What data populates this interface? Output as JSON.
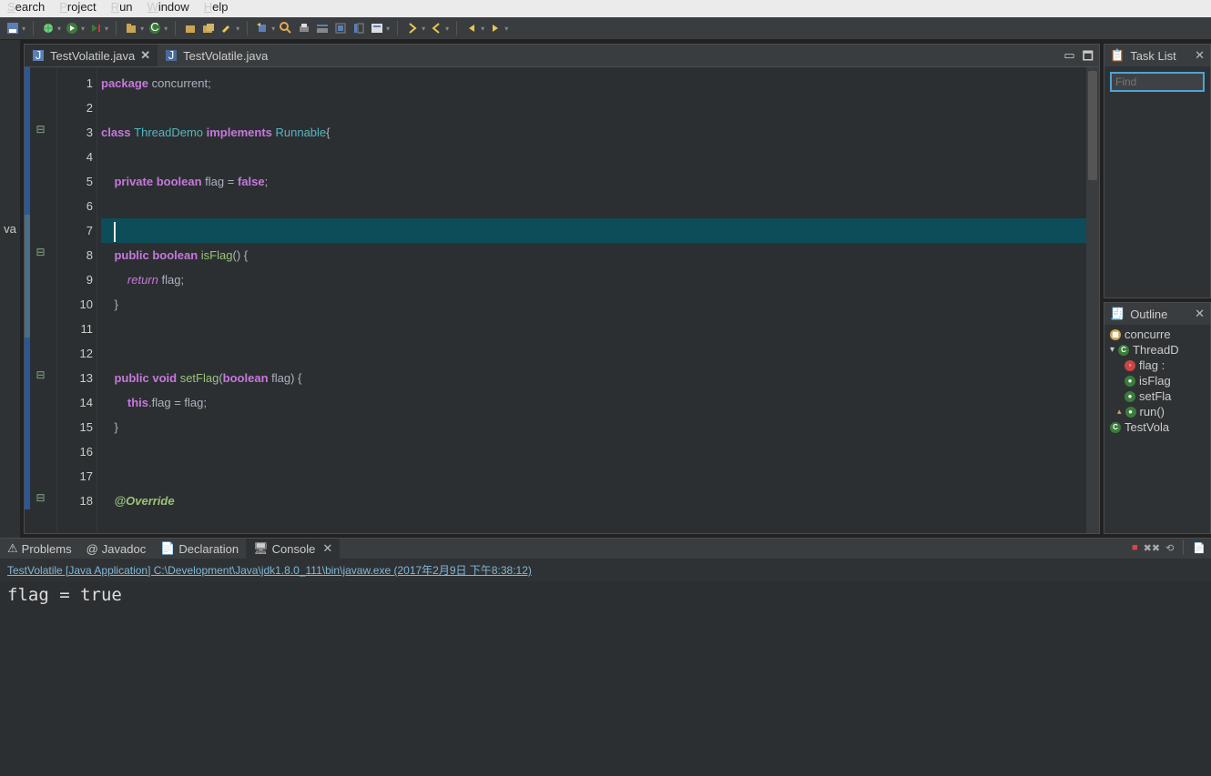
{
  "menu": {
    "items": [
      "Search",
      "Project",
      "Run",
      "Window",
      "Help"
    ],
    "ul": [
      "S",
      "P",
      "R",
      "W",
      "H"
    ]
  },
  "left_sash_label": "va",
  "tabs": [
    {
      "name": "TestVolatile.java",
      "active": true,
      "closeable": true
    },
    {
      "name": "TestVolatile.java",
      "active": false,
      "closeable": false
    }
  ],
  "code": [
    {
      "n": 1,
      "strip": 2,
      "tokens": [
        {
          "t": "package ",
          "c": "kw"
        },
        {
          "t": "concurrent",
          "c": "id"
        },
        {
          "t": ";",
          "c": "p"
        }
      ]
    },
    {
      "n": 2,
      "strip": 2,
      "tokens": []
    },
    {
      "n": 3,
      "strip": 2,
      "tokens": [
        {
          "t": "class ",
          "c": "kw"
        },
        {
          "t": "ThreadDemo ",
          "c": "type"
        },
        {
          "t": "implements ",
          "c": "kw"
        },
        {
          "t": "Runnable",
          "c": "type"
        },
        {
          "t": "{",
          "c": "p"
        }
      ],
      "fold": "-"
    },
    {
      "n": 4,
      "strip": 2,
      "tokens": []
    },
    {
      "n": 5,
      "strip": 2,
      "tokens": [
        {
          "t": "    ",
          "c": "p"
        },
        {
          "t": "private ",
          "c": "kw"
        },
        {
          "t": "boolean ",
          "c": "kw"
        },
        {
          "t": "flag ",
          "c": "id"
        },
        {
          "t": "= ",
          "c": "p"
        },
        {
          "t": "false",
          "c": "lit"
        },
        {
          "t": ";",
          "c": "p"
        }
      ]
    },
    {
      "n": 6,
      "strip": 2,
      "tokens": []
    },
    {
      "n": 7,
      "strip": 1,
      "current": true,
      "tokens": [
        {
          "t": "    ",
          "c": "p"
        }
      ]
    },
    {
      "n": 8,
      "strip": 1,
      "tokens": [
        {
          "t": "    ",
          "c": "p"
        },
        {
          "t": "public ",
          "c": "kw"
        },
        {
          "t": "boolean ",
          "c": "kw"
        },
        {
          "t": "isFlag",
          "c": "mname"
        },
        {
          "t": "() {",
          "c": "p"
        }
      ],
      "fold": "-"
    },
    {
      "n": 9,
      "strip": 1,
      "tokens": [
        {
          "t": "        ",
          "c": "p"
        },
        {
          "t": "return ",
          "c": "kw2"
        },
        {
          "t": "flag",
          "c": "id"
        },
        {
          "t": ";",
          "c": "p"
        }
      ]
    },
    {
      "n": 10,
      "strip": 1,
      "tokens": [
        {
          "t": "    }",
          "c": "p"
        }
      ]
    },
    {
      "n": 11,
      "strip": 1,
      "tokens": []
    },
    {
      "n": 12,
      "strip": 2,
      "tokens": []
    },
    {
      "n": 13,
      "strip": 2,
      "tokens": [
        {
          "t": "    ",
          "c": "p"
        },
        {
          "t": "public ",
          "c": "kw"
        },
        {
          "t": "void ",
          "c": "kw"
        },
        {
          "t": "setFlag",
          "c": "mname"
        },
        {
          "t": "(",
          "c": "p"
        },
        {
          "t": "boolean ",
          "c": "kw"
        },
        {
          "t": "flag",
          "c": "id"
        },
        {
          "t": ") {",
          "c": "p"
        }
      ],
      "fold": "-"
    },
    {
      "n": 14,
      "strip": 2,
      "tokens": [
        {
          "t": "        ",
          "c": "p"
        },
        {
          "t": "this",
          "c": "kw"
        },
        {
          "t": ".flag = flag;",
          "c": "p"
        }
      ]
    },
    {
      "n": 15,
      "strip": 2,
      "tokens": [
        {
          "t": "    }",
          "c": "p"
        }
      ]
    },
    {
      "n": 16,
      "strip": 2,
      "tokens": []
    },
    {
      "n": 17,
      "strip": 2,
      "tokens": []
    },
    {
      "n": 18,
      "strip": 2,
      "tokens": [
        {
          "t": "    ",
          "c": "p"
        },
        {
          "t": "@Override",
          "c": "ann"
        }
      ],
      "fold": "-"
    }
  ],
  "task": {
    "title": "Task List",
    "find_ph": "Find"
  },
  "outline": {
    "title": "Outline",
    "items": [
      {
        "ic": "pkg",
        "label": "concurre"
      },
      {
        "ic": "class",
        "label": "ThreadD",
        "exp": true
      },
      {
        "ic": "field",
        "label": "flag :",
        "indent": 22
      },
      {
        "ic": "method",
        "label": "isFlag",
        "indent": 22
      },
      {
        "ic": "method",
        "label": "setFla",
        "indent": 22
      },
      {
        "ic": "method",
        "label": "run()",
        "indent": 14,
        "over": true
      },
      {
        "ic": "class",
        "label": "TestVola"
      }
    ]
  },
  "bottom": {
    "tabs": [
      "Problems",
      "Javadoc",
      "Declaration",
      "Console"
    ],
    "active": 3,
    "path": "TestVolatile [Java Application] C:\\Development\\Java\\jdk1.8.0_111\\bin\\javaw.exe (2017年2月9日 下午8:38:12)",
    "output": "flag = true"
  }
}
